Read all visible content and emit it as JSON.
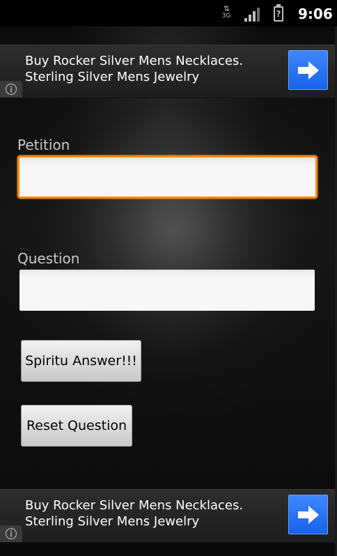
{
  "status_bar": {
    "network_type": "3G",
    "network_arrows": "⇅",
    "battery_glyph": "?",
    "time": "9:06"
  },
  "ads": {
    "top": {
      "text": "Buy Rocker Silver Mens Necklaces. Sterling Silver Mens Jewelry"
    },
    "bottom": {
      "text": "Buy Rocker Silver Mens Necklaces. Sterling Silver Mens Jewelry"
    }
  },
  "form": {
    "petition_label": "Petition",
    "petition_value": "",
    "question_label": "Question",
    "question_value": "",
    "answer_button": "Spiritu Answer!!!",
    "reset_button": "Reset Question"
  },
  "colors": {
    "focus_border": "#ff8a00",
    "ad_button": "#1763e8",
    "label_text": "#c9c9c9"
  },
  "icons": {
    "ad_arrow": "arrow-right-icon",
    "ad_info": "info-icon",
    "signal": "signal-strength-icon",
    "battery": "battery-unknown-icon",
    "network": "3g-data-icon"
  }
}
